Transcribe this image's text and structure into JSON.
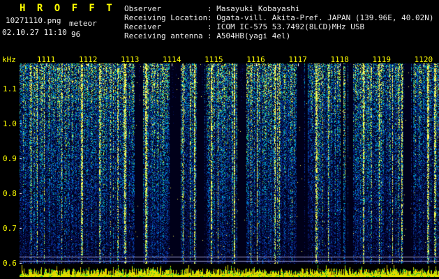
{
  "app": {
    "title": "H R O F F T"
  },
  "file_info": {
    "filename": "10271110.png",
    "mode": "meteor",
    "datetime": "02.10.27 11:10",
    "count": "96"
  },
  "observer_info": {
    "rows": [
      {
        "label": "Observer",
        "value": "Masayuki Kobayashi"
      },
      {
        "label": "Receiving Location",
        "value": "Ogata-vill. Akita-Pref. JAPAN (139.96E, 40.02N)"
      },
      {
        "label": "Receiver",
        "value": "ICOM IC-575 53.7492(8LCD)MHz USB"
      },
      {
        "label": "Receiving antenna",
        "value": "A504HB(yagi 4el)"
      }
    ]
  },
  "chart_data": {
    "type": "heatmap",
    "title": "HROFFT radio meteor echo spectrogram",
    "ylabel": "kHz",
    "y_ticks": [
      "1.1",
      "1.0",
      "0.9",
      "0.8",
      "0.7",
      "0.6"
    ],
    "y_range": [
      0.6,
      1.17
    ],
    "x_ticks": [
      "1111",
      "1112",
      "1113",
      "1114",
      "1115",
      "1116",
      "1117",
      "1118",
      "1119",
      "1120"
    ],
    "x_range": [
      "11:10",
      "11:20"
    ],
    "grid": false,
    "legend_position": "none",
    "colors": {
      "axis_label": "#ffff00",
      "tick_mark": "#ffffff",
      "h_line": "#a0a0d7",
      "meter_bar": "#dddd00",
      "meter_accent": "#00bb33",
      "meter_hot": "#ff9900"
    },
    "render": {
      "seed": 1372,
      "meter_seed": 991,
      "streaks": [
        25,
        60,
        88,
        114,
        150,
        180,
        234,
        250,
        274,
        284,
        307,
        340,
        365,
        372,
        424,
        442,
        464,
        492,
        515,
        534,
        547,
        584,
        594
      ],
      "dark_bands": [
        [
          165,
          176
        ],
        [
          215,
          230
        ],
        [
          254,
          268
        ],
        [
          312,
          324
        ],
        [
          397,
          412
        ],
        [
          460,
          477
        ],
        [
          550,
          564
        ]
      ],
      "h_lines": [
        277,
        283
      ],
      "palette": [
        [
          0.32,
          0,
          0,
          25
        ],
        [
          0.48,
          8,
          20,
          100
        ],
        [
          0.6,
          10,
          60,
          170
        ],
        [
          0.7,
          0,
          120,
          210
        ],
        [
          0.79,
          0,
          185,
          200
        ],
        [
          0.86,
          40,
          200,
          120
        ],
        [
          0.93,
          150,
          220,
          40
        ],
        [
          9,
          255,
          255,
          90
        ]
      ]
    }
  }
}
